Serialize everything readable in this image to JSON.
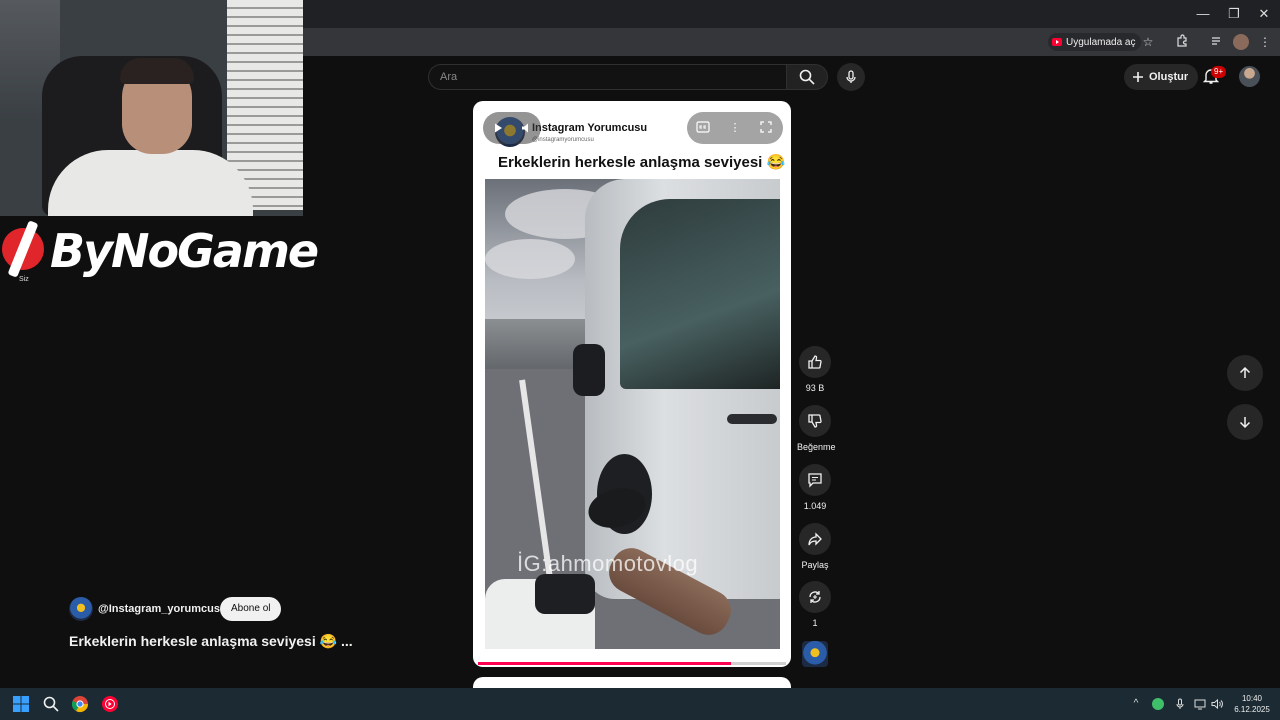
{
  "browser": {
    "open_in_app_label": "Uygulamada aç",
    "window_controls": [
      "—",
      "❐",
      "✕"
    ]
  },
  "header": {
    "search_placeholder": "Ara",
    "create_label": "Oluştur",
    "notifications_badge": "9+"
  },
  "overlay": {
    "logo_text": "ByNoGame",
    "siz_label": "Siz"
  },
  "short": {
    "channel_name": "Instagram Yorumcusu",
    "channel_handle": "@instagramyorumcusu",
    "caption": "Erkeklerin herkesle anlaşma seviyesi 😂",
    "watermark": "İG:ahmomotovlog",
    "progress_fraction": 0.82
  },
  "actions": {
    "like_count": "93 B",
    "dislike_label": "Beğenme",
    "comment_count": "1.049",
    "share_label": "Paylaş",
    "remix_count": "1"
  },
  "info": {
    "channel_handle": "@Instagram_yorumcusu",
    "subscribe_label": "Abone ol",
    "title": "Erkeklerin herkesle anlaşma seviyesi 😂 ..."
  },
  "taskbar": {
    "time": "10:40",
    "date": "6.12.2025"
  },
  "colors": {
    "brand_red": "#ff0033",
    "progress": "#ff0050",
    "background": "#0f0f0f"
  }
}
